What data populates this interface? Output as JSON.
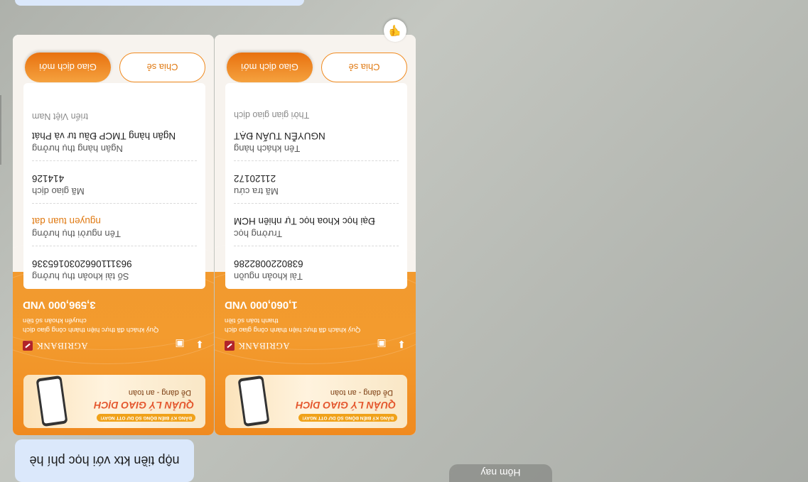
{
  "day_separator": "Hôm nay",
  "message_text": "nộp tiền ktx với học phí hè",
  "reaction_icon": "thumbs-down-icon",
  "receipts": [
    {
      "bank_name": "AGRIBANK",
      "banner_title": "QUẢN LÝ GIAO DỊCH",
      "banner_sub": "Dễ dàng - an toàn",
      "banner_tag": "ĐĂNG KÝ BIẾN ĐỘNG SỐ DƯ OTT NGAY!",
      "success_msg": "Quý khách đã thực hiện thành công giao dịch",
      "success_msg2": "thanh toán số tiền",
      "amount": "1,060,000 VND",
      "rows": [
        {
          "label": "Tài khoản nguồn",
          "value": "6380220082286"
        },
        {
          "label": "Trường học",
          "value": "Đại học Khoa học Tự nhiên HCM"
        },
        {
          "label": "Mã tra cứu",
          "value": "21120172"
        },
        {
          "label": "Tên khách hàng",
          "value": "NGUYỄN TUẤN ĐẠT"
        }
      ],
      "tail_label": "Thời gian giao dịch",
      "share_label": "Chia sẻ",
      "new_label": "Giao dịch mới"
    },
    {
      "bank_name": "AGRIBANK",
      "banner_title": "QUẢN LÝ GIAO DỊCH",
      "banner_sub": "Dễ dàng - an toàn",
      "banner_tag": "ĐĂNG KÝ BIẾN ĐỘNG SỐ DƯ OTT NGAY!",
      "success_msg": "Quý khách đã thực hiện thành công giao dịch",
      "success_msg2": "chuyển khoản số tiền",
      "amount": "3,596,000 VND",
      "rows": [
        {
          "label": "Số tài khoản thụ hưởng",
          "value": "9631110662030165336"
        },
        {
          "label": "Tên người thụ hưởng",
          "value": "nguyen tuan dat"
        },
        {
          "label": "Mã giao dịch",
          "value": "414126"
        },
        {
          "label": "Ngân hàng thụ hưởng",
          "value": "Ngân hàng TMCP Đầu tư và Phát"
        }
      ],
      "tail_label": "triển Việt Nam",
      "share_label": "Chia sẻ",
      "new_label": "Giao dịch mới"
    }
  ]
}
